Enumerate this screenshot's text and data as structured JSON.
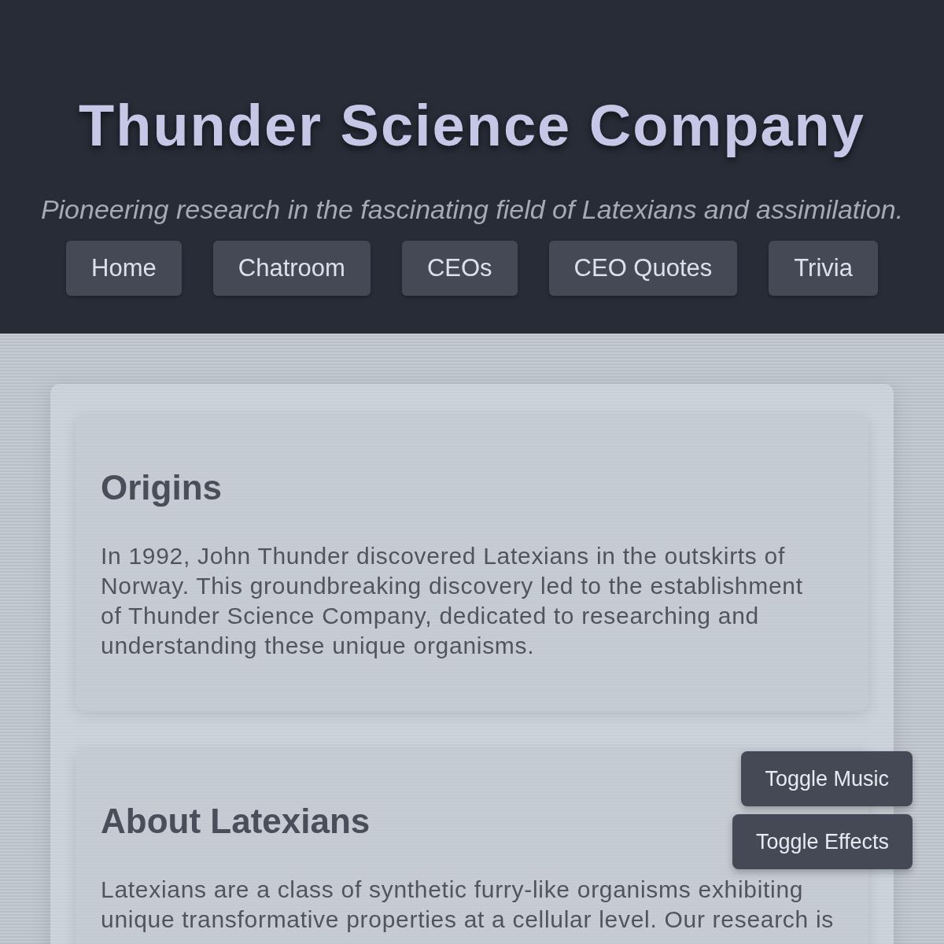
{
  "header": {
    "title": "Thunder Science Company",
    "tagline": "Pioneering research in the fascinating field of Latexians and assimilation."
  },
  "nav": [
    "Home",
    "Chatroom",
    "CEOs",
    "CEO Quotes",
    "Trivia"
  ],
  "sections": [
    {
      "heading": "Origins",
      "body": "In 1992, John Thunder discovered Latexians in the outskirts of Norway. This groundbreaking discovery led to the establishment of Thunder Science Company, dedicated to researching and understanding these unique organisms."
    },
    {
      "heading": "About Latexians",
      "body": "Latexians are a class of synthetic furry-like organisms exhibiting unique transformative properties at a cellular level. Our research is"
    }
  ],
  "floating_buttons": [
    "Toggle Music",
    "Toggle Effects"
  ]
}
